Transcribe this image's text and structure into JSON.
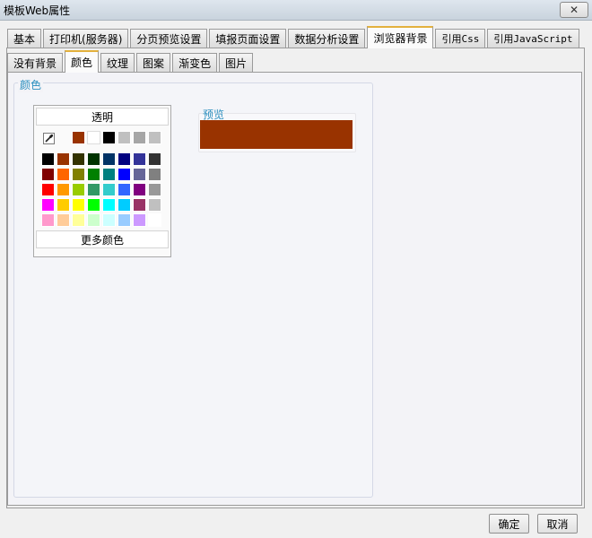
{
  "window": {
    "title": "模板Web属性",
    "close_glyph": "✕"
  },
  "tabs_top": [
    {
      "label": "基本"
    },
    {
      "label": "打印机(服务器)"
    },
    {
      "label": "分页预览设置"
    },
    {
      "label": "填报页面设置"
    },
    {
      "label": "数据分析设置"
    },
    {
      "label": "浏览器背景",
      "active": true
    },
    {
      "label": "引用Css"
    },
    {
      "label": "引用JavaScript"
    }
  ],
  "tabs_sub": [
    {
      "label": "没有背景"
    },
    {
      "label": "颜色",
      "active": true
    },
    {
      "label": "纹理"
    },
    {
      "label": "图案"
    },
    {
      "label": "渐变色"
    },
    {
      "label": "图片"
    }
  ],
  "color_group": {
    "label": "颜色",
    "transparent_label": "透明",
    "more_colors_label": "更多颜色",
    "eyedropper_icon": "eyedropper-icon",
    "recent_colors": [
      "#993300",
      "#ffffff",
      "#000000",
      "#c0c0c0",
      "#a6a6a6",
      "#c0c0c0"
    ],
    "palette": [
      [
        "#000000",
        "#993300",
        "#333300",
        "#003300",
        "#003366",
        "#000080",
        "#333399",
        "#333333"
      ],
      [
        "#800000",
        "#ff6600",
        "#808000",
        "#008000",
        "#008080",
        "#0000ff",
        "#666699",
        "#808080"
      ],
      [
        "#ff0000",
        "#ff9900",
        "#99cc00",
        "#339966",
        "#33cccc",
        "#3366ff",
        "#800080",
        "#999999"
      ],
      [
        "#ff00ff",
        "#ffcc00",
        "#ffff00",
        "#00ff00",
        "#00ffff",
        "#00ccff",
        "#993366",
        "#c0c0c0"
      ],
      [
        "#ff99cc",
        "#ffcc99",
        "#ffff99",
        "#ccffcc",
        "#ccffff",
        "#99ccff",
        "#cc99ff",
        "#ffffff"
      ]
    ]
  },
  "preview": {
    "label": "预览",
    "color": "#993300"
  },
  "buttons": {
    "ok": "确定",
    "cancel": "取消"
  }
}
